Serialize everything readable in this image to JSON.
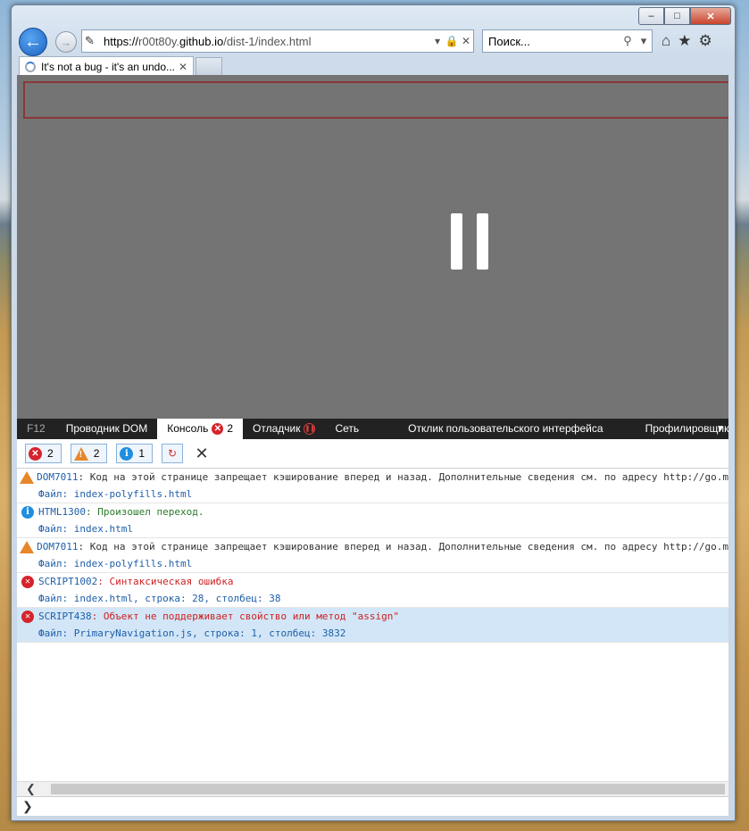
{
  "window": {
    "caption": {
      "minimize": "–",
      "maximize": "□",
      "close": "✕"
    }
  },
  "nav": {
    "back_icon": "←",
    "forward_icon": "→",
    "address": {
      "scheme": "https://",
      "host_prefix": "r00t80y.",
      "host": "github.io",
      "path": "/dist-1/index.html"
    },
    "lock_icon": "🔒",
    "stop_icon": "✕",
    "refresh_icon": "▾",
    "search_placeholder": "Поиск...",
    "search_icon": "⚲",
    "search_drop": "▾",
    "home_icon": "⌂",
    "fav_icon": "★",
    "gear_icon": "⚙"
  },
  "tab": {
    "title": "It's not a bug - it's an undo...",
    "close": "✕"
  },
  "devtools": {
    "tabs": [
      {
        "label": "F12"
      },
      {
        "label": "Проводник DOM"
      },
      {
        "label": "Консоль",
        "badge": "2"
      },
      {
        "label": "Отладчик"
      },
      {
        "label": "Сеть"
      },
      {
        "label": "Отклик пользовательского интерфейса"
      },
      {
        "label": "Профилировщик"
      }
    ],
    "filters": {
      "errors": "2",
      "warnings": "2",
      "info": "1"
    },
    "messages": [
      {
        "type": "warn",
        "code": "DOM7011",
        "text": ": Код на этой странице запрещает кэширование вперед и назад. Дополнительные сведения см. по адресу http://go.m",
        "file": "Файл: index-polyfills.html"
      },
      {
        "type": "info",
        "code": "HTML1300",
        "text": ": Произошел переход.",
        "file": "Файл: index.html"
      },
      {
        "type": "warn",
        "code": "DOM7011",
        "text": ": Код на этой странице запрещает кэширование вперед и назад. Дополнительные сведения см. по адресу http://go.m",
        "file": "Файл: index-polyfills.html"
      },
      {
        "type": "error",
        "code": "SCRIPT1002",
        "text": ": Синтаксическая ошибка",
        "file": "Файл: index.html, строка: 28, столбец: 38"
      },
      {
        "type": "error",
        "code": "SCRIPT438",
        "text": ": Объект не поддерживает свойство или метод \"assign\"",
        "file": "Файл: PrimaryNavigation.js, строка: 1, столбец: 3832",
        "selected": true
      }
    ],
    "scroll_left": "❮",
    "prompt": "❯"
  }
}
